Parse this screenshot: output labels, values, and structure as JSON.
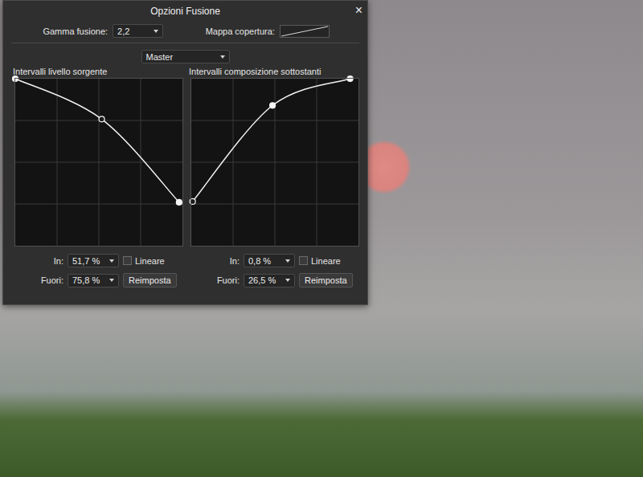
{
  "window": {
    "title": "Opzioni Fusione",
    "close": "×"
  },
  "blend_gamma": {
    "label": "Gamma fusione:",
    "value": "2,2"
  },
  "coverage_map": {
    "label": "Mappa copertura:"
  },
  "channel": {
    "value": "Master"
  },
  "panels": [
    {
      "title": "Intervalli livello sorgente",
      "points": [
        {
          "x": 0,
          "y": 1,
          "selected": false
        },
        {
          "x": 0.517,
          "y": 0.758,
          "selected": true
        },
        {
          "x": 0.98,
          "y": 0.26,
          "selected": false
        }
      ],
      "in": {
        "label": "In:",
        "value": "51,7 %"
      },
      "out": {
        "label": "Fuori:",
        "value": "75,8 %"
      },
      "linear": {
        "label": "Lineare",
        "checked": false
      },
      "reset": "Reimposta"
    },
    {
      "title": "Intervalli composizione sottostanti",
      "points": [
        {
          "x": 0.008,
          "y": 0.265,
          "selected": true
        },
        {
          "x": 0.486,
          "y": 0.84,
          "selected": false
        },
        {
          "x": 0.95,
          "y": 1,
          "selected": false
        }
      ],
      "in": {
        "label": "In:",
        "value": "0,8 %"
      },
      "out": {
        "label": "Fuori:",
        "value": "26,5 %"
      },
      "linear": {
        "label": "Lineare",
        "checked": false
      },
      "reset": "Reimposta"
    }
  ]
}
